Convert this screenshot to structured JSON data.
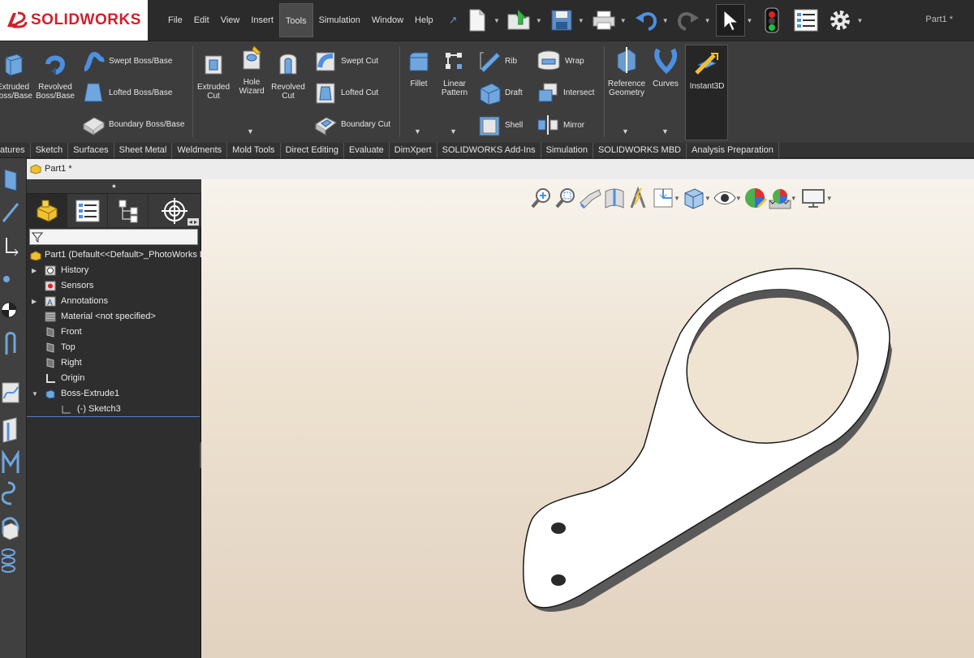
{
  "app": {
    "brand": "SOLIDWORKS",
    "doc_title": "Part1 *",
    "accent": "#d0202a"
  },
  "menu": [
    "File",
    "Edit",
    "View",
    "Insert",
    "Tools",
    "Simulation",
    "Window",
    "Help"
  ],
  "menu_active": "Tools",
  "ribbon": {
    "extruded_boss": "Extruded Boss/Base",
    "revolved_boss": "Revolved Boss/Base",
    "swept_boss": "Swept Boss/Base",
    "lofted_boss": "Lofted Boss/Base",
    "boundary_boss": "Boundary Boss/Base",
    "extruded_cut": "Extruded Cut",
    "hole_wizard": "Hole Wizard",
    "revolved_cut": "Revolved Cut",
    "swept_cut": "Swept Cut",
    "lofted_cut": "Lofted Cut",
    "boundary_cut": "Boundary Cut",
    "fillet": "Fillet",
    "linear_pattern": "Linear Pattern",
    "rib": "Rib",
    "draft": "Draft",
    "shell": "Shell",
    "wrap": "Wrap",
    "intersect": "Intersect",
    "mirror": "Mirror",
    "reference_geometry": "Reference Geometry",
    "curves": "Curves",
    "instant3d": "Instant3D"
  },
  "tabs": [
    "atures",
    "Sketch",
    "Surfaces",
    "Sheet Metal",
    "Weldments",
    "Mold Tools",
    "Direct Editing",
    "Evaluate",
    "DimXpert",
    "SOLIDWORKS Add-Ins",
    "Simulation",
    "SOLIDWORKS MBD",
    "Analysis Preparation"
  ],
  "doc_tab": "Part1 *",
  "tree": {
    "root": "Part1  (Default<<Default>_PhotoWorks D",
    "items": [
      {
        "label": "History",
        "icon": "history-icon",
        "expandable": true
      },
      {
        "label": "Sensors",
        "icon": "sensor-icon",
        "expandable": false
      },
      {
        "label": "Annotations",
        "icon": "annotation-icon",
        "expandable": true
      },
      {
        "label": "Material <not specified>",
        "icon": "material-icon",
        "expandable": false
      },
      {
        "label": "Front",
        "icon": "plane-icon",
        "expandable": false
      },
      {
        "label": "Top",
        "icon": "plane-icon",
        "expandable": false
      },
      {
        "label": "Right",
        "icon": "plane-icon",
        "expandable": false
      },
      {
        "label": "Origin",
        "icon": "origin-icon",
        "expandable": false
      },
      {
        "label": "Boss-Extrude1",
        "icon": "extrude-icon",
        "expanded": true
      },
      {
        "label": "(-) Sketch3",
        "icon": "sketch-icon",
        "child": true
      }
    ]
  }
}
